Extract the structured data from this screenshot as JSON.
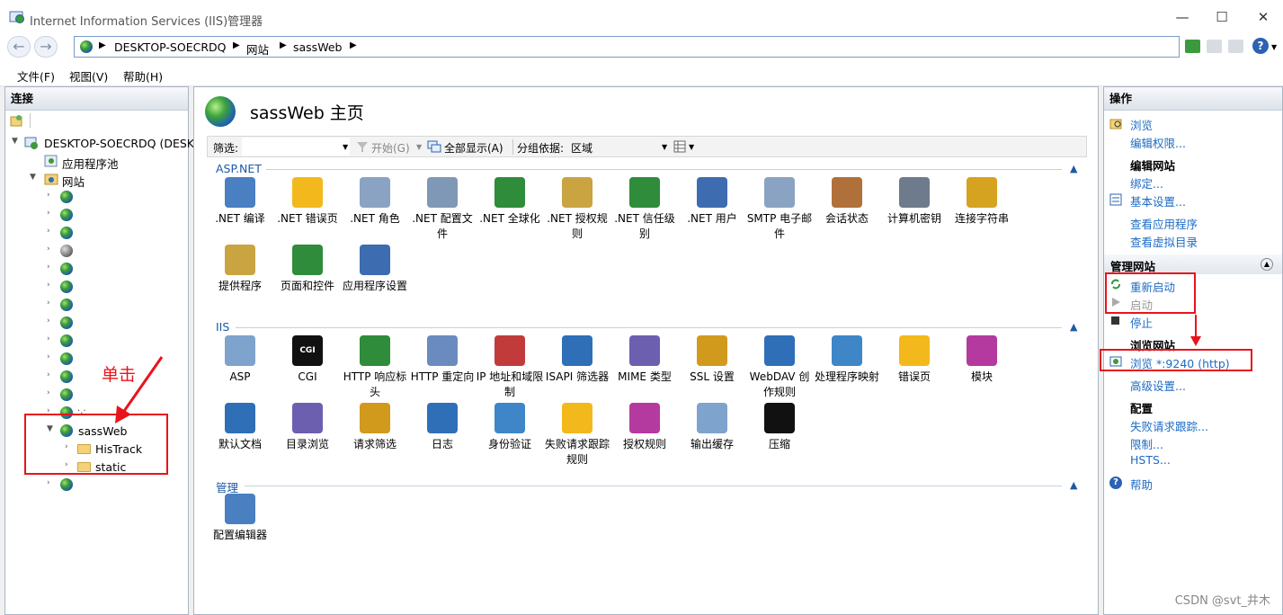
{
  "window": {
    "title": "Internet Information Services (IIS)管理器",
    "controls": [
      "—",
      "☐",
      "✕"
    ]
  },
  "nav": {
    "back": "←",
    "forward": "→",
    "crumbs": [
      "DESKTOP-SOECRDQ",
      "网站",
      "sassWeb"
    ],
    "sep": "▶",
    "help": "?"
  },
  "menu": [
    "文件(F)",
    "视图(V)",
    "帮助(H)"
  ],
  "connections": {
    "header": "连接",
    "server": "DESKTOP-SOECRDQ (DESK",
    "app_pool": "应用程序池",
    "sites": "网站",
    "hidden_site_label": "·,·",
    "selected_site": "sassWeb",
    "children": [
      "HisTrack",
      "static"
    ]
  },
  "annotation": {
    "click": "单击"
  },
  "main": {
    "title": "sassWeb 主页",
    "filter": {
      "label": "筛选:",
      "start": "开始(G)",
      "show_all": "全部显示(A)",
      "group_label": "分组依据:",
      "group_value": "区域"
    },
    "groups": [
      {
        "name": "ASP.NET",
        "rows": [
          [
            ".NET 编译",
            ".NET 错误页",
            ".NET 角色",
            ".NET 配置文件",
            ".NET 全球化",
            ".NET 授权规则",
            ".NET 信任级别",
            ".NET 用户",
            "SMTP 电子邮件",
            "会话状态",
            "计算机密钥",
            "连接字符串"
          ],
          [
            "提供程序",
            "页面和控件",
            "应用程序设置"
          ]
        ]
      },
      {
        "name": "IIS",
        "rows": [
          [
            "ASP",
            "CGI",
            "HTTP 响应标头",
            "HTTP 重定向",
            "IP 地址和域限制",
            "ISAPI 筛选器",
            "MIME 类型",
            "SSL 设置",
            "WebDAV 创作规则",
            "处理程序映射",
            "错误页",
            "模块"
          ],
          [
            "默认文档",
            "目录浏览",
            "请求筛选",
            "日志",
            "身份验证",
            "失败请求跟踪规则",
            "授权规则",
            "输出缓存",
            "压缩"
          ]
        ]
      },
      {
        "name": "管理",
        "rows": [
          [
            "配置编辑器"
          ]
        ]
      }
    ]
  },
  "actions": {
    "header": "操作",
    "explore": "浏览",
    "edit_perm": "编辑权限...",
    "edit_site": "编辑网站",
    "bindings": "绑定...",
    "basic": "基本设置...",
    "view_apps": "查看应用程序",
    "view_vdirs": "查看虚拟目录",
    "manage_site": "管理网站",
    "restart": "重新启动",
    "start": "启动",
    "stop": "停止",
    "browse_site": "浏览网站",
    "browse_link": "浏览 *:9240 (http)",
    "advanced": "高级设置...",
    "config": "配置",
    "failed_req": "失败请求跟踪...",
    "limits": "限制...",
    "hsts": "HSTS...",
    "help": "帮助"
  },
  "watermark": "CSDN @svt_井木"
}
